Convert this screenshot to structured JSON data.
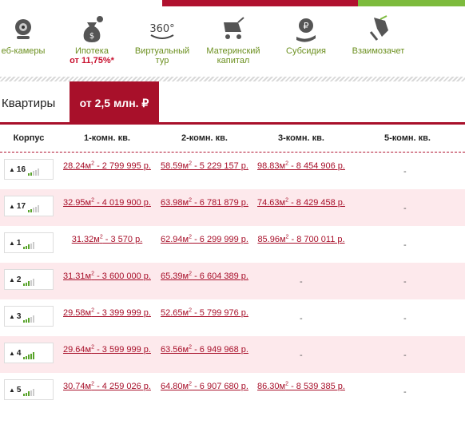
{
  "features": [
    {
      "icon": "webcam-icon",
      "label": "еб-камеры",
      "sub": ""
    },
    {
      "icon": "money-bag-icon",
      "label": "Ипотека",
      "sub": "от 11,75%*"
    },
    {
      "icon": "360-icon",
      "label": "Виртуальный тур",
      "sub": ""
    },
    {
      "icon": "baby-stroller-icon",
      "label": "Материнский капитал",
      "sub": ""
    },
    {
      "icon": "ruble-hand-icon",
      "label": "Субсидия",
      "sub": ""
    },
    {
      "icon": "keys-icon",
      "label": "Взаимозачет",
      "sub": ""
    }
  ],
  "section": {
    "title": "Квартиры",
    "price_badge": "от 2,5 млн. ₽"
  },
  "table": {
    "headers": [
      "Корпус",
      "1-комн. кв.",
      "2-комн. кв.",
      "3-комн. кв.",
      "5-комн. кв."
    ],
    "rows": [
      {
        "korpus": "16",
        "level": 2,
        "c1": {
          "area": "28.24м",
          "price": " - 2 799 995 р."
        },
        "c2": {
          "area": "58.59м",
          "price": " - 5 229 157 р."
        },
        "c3": {
          "area": "98.83м",
          "price": " - 8 454 906 р."
        },
        "c5": "-"
      },
      {
        "korpus": "17",
        "level": 2,
        "c1": {
          "area": "32.95м",
          "price": " - 4 019 900 р."
        },
        "c2": {
          "area": "63.98м",
          "price": " - 6 781 879 р."
        },
        "c3": {
          "area": "74.63м",
          "price": " - 8 429 458 р."
        },
        "c5": "-"
      },
      {
        "korpus": "1",
        "level": 3,
        "c1": {
          "area": "31.32м",
          "price": " - 3 570 р."
        },
        "c2": {
          "area": "62.94м",
          "price": " - 6 299 999 р."
        },
        "c3": {
          "area": "85.96м",
          "price": " - 8 700 011 р."
        },
        "c5": "-"
      },
      {
        "korpus": "2",
        "level": 3,
        "c1": {
          "area": "31.31м",
          "price": " - 3 600 000 р."
        },
        "c2": {
          "area": "65.39м",
          "price": " - 6 604 389 р."
        },
        "c3": "-",
        "c5": "-"
      },
      {
        "korpus": "3",
        "level": 3,
        "c1": {
          "area": "29.58м",
          "price": " - 3 399 999 р."
        },
        "c2": {
          "area": "52.65м",
          "price": " - 5 799 976 р."
        },
        "c3": "-",
        "c5": "-"
      },
      {
        "korpus": "4",
        "level": 5,
        "c1": {
          "area": "29.64м",
          "price": " - 3 599 999 р."
        },
        "c2": {
          "area": "63.56м",
          "price": " - 6 949 968 р."
        },
        "c3": "-",
        "c5": "-"
      },
      {
        "korpus": "5",
        "level": 3,
        "c1": {
          "area": "30.74м",
          "price": " - 4 259 026 р."
        },
        "c2": {
          "area": "64.80м",
          "price": " - 6 907 680 р."
        },
        "c3": {
          "area": "86.30м",
          "price": " - 8 539 385 р."
        },
        "c5": "-"
      }
    ]
  },
  "colors": {
    "brand_red": "#a8102a",
    "green": "#7dbb3d",
    "row_pink": "#fde9ec"
  }
}
